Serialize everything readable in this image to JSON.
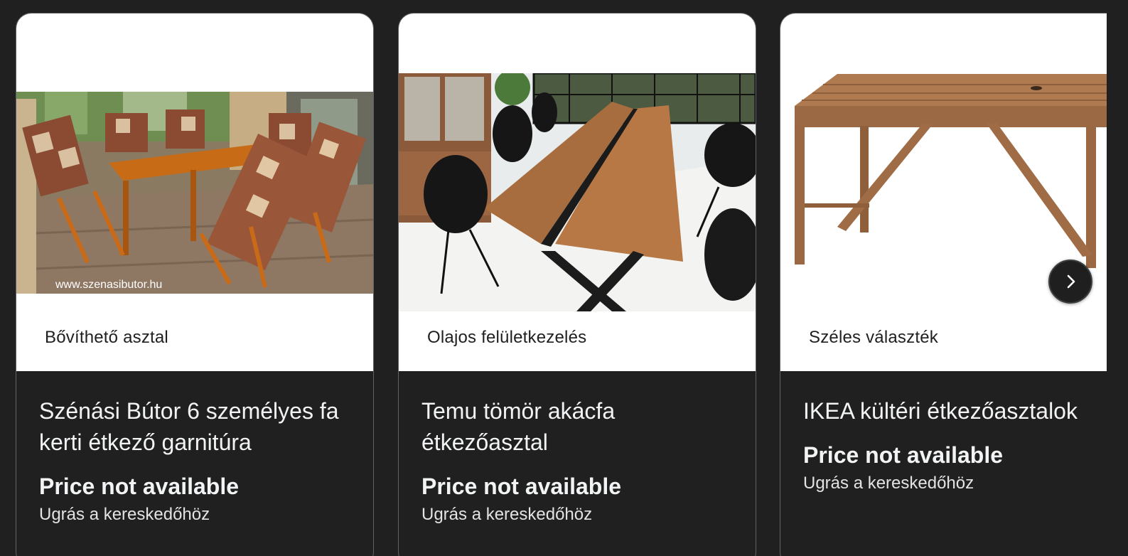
{
  "cards": [
    {
      "tagline": "Bővíthető asztal",
      "title": "Szénási Bútor 6 személyes fa kerti étkező garnitúra",
      "price": "Price not available",
      "merchant_link": "Ugrás a kereskedőhöz",
      "image": {
        "subject": "wooden garden dining set with checkered cushions on a terrace",
        "watermark": "www.szenasibutor.hu"
      }
    },
    {
      "tagline": "Olajos felületkezelés",
      "title": "Temu tömör akácfa étkezőasztal",
      "price": "Price not available",
      "merchant_link": "Ugrás a kereskedőhöz",
      "image": {
        "subject": "live-edge acacia dining table with black resin strip and black chairs"
      }
    },
    {
      "tagline": "Széles választék",
      "title": "IKEA kültéri étkezőasztalok",
      "price": "Price not available",
      "merchant_link": "Ugrás a kereskedőhöz",
      "image": {
        "subject": "slatted wooden outdoor table on white background"
      }
    }
  ],
  "controls": {
    "next_icon": "chevron-right-icon"
  },
  "colors": {
    "page_background": "#202020",
    "card_border": "#5f6368",
    "card_top_background": "#ffffff",
    "text_primary": "#f1f3f4",
    "text_secondary": "#e3e3e3"
  }
}
